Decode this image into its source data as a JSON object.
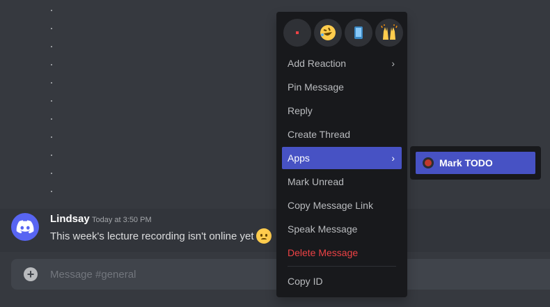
{
  "message": {
    "author": "Lindsay",
    "timestamp": "Today at 3:50 PM",
    "content": "This week's lecture recording isn't online yet",
    "emoji": "frowning-face"
  },
  "composer": {
    "placeholder": "Message #general",
    "add_button": "+"
  },
  "context_menu": {
    "quick_reactions": [
      "small-red-square",
      "rolling-laughing",
      "mobile-phone",
      "raising-hands"
    ],
    "items": {
      "add_reaction": "Add Reaction",
      "pin_message": "Pin Message",
      "reply": "Reply",
      "create_thread": "Create Thread",
      "apps": "Apps",
      "mark_unread": "Mark Unread",
      "copy_message_link": "Copy Message Link",
      "speak_message": "Speak Message",
      "delete_message": "Delete Message",
      "copy_id": "Copy ID"
    },
    "chevron": "›"
  },
  "apps_submenu": {
    "items": [
      "Mark TODO"
    ]
  },
  "colors": {
    "background": "#36393f",
    "menu": "#18191c",
    "accent": "#4752c4",
    "danger": "#ed4245",
    "blurple": "#5865f2"
  }
}
